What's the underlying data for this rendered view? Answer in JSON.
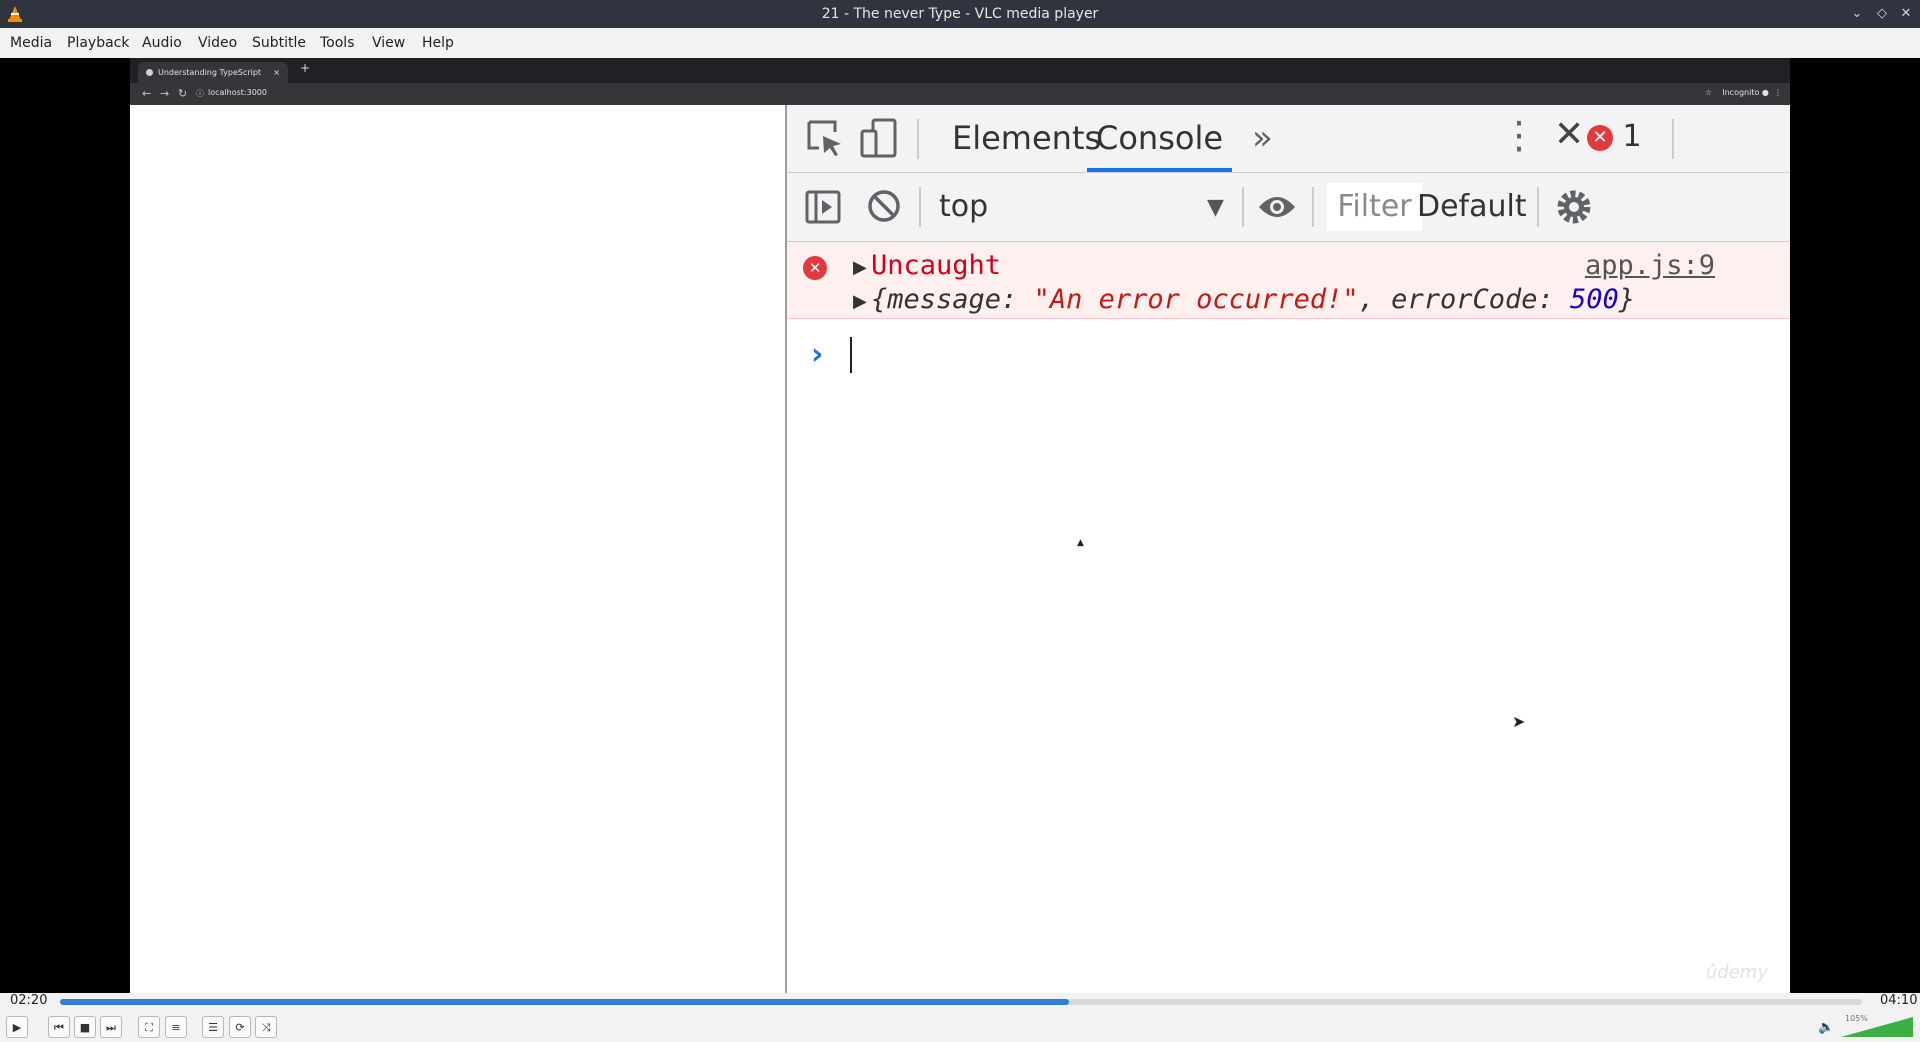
{
  "window": {
    "title": "21 - The never Type - VLC media player",
    "controls": [
      "minimize-icon",
      "maximize-icon",
      "close-icon"
    ]
  },
  "menubar": {
    "items": [
      "Media",
      "Playback",
      "Audio",
      "Video",
      "Subtitle",
      "Tools",
      "View",
      "Help"
    ]
  },
  "browser": {
    "tab_title": "Understanding TypeScript",
    "tab_close": "×",
    "new_tab": "+",
    "url": "localhost:3000",
    "incognito": "Incognito"
  },
  "devtools": {
    "tabs": [
      "Elements",
      "Console"
    ],
    "active_tab": "Console",
    "more_tabs": "»",
    "error_count": "1",
    "context": "top",
    "filter_placeholder": "Filter",
    "levels": "Default le",
    "console": {
      "uncaught": "Uncaught",
      "source": "app.js:9",
      "obj_open": "{message: ",
      "obj_message": "\"An error occurred!\"",
      "obj_mid": ", errorCode: ",
      "obj_code": "500",
      "obj_close": "}"
    },
    "watermark": "ûdemy"
  },
  "player": {
    "elapsed": "02:20",
    "total": "04:10",
    "progress": 0.56,
    "volume": "105%",
    "volume_level": 1.05,
    "colors": {
      "seek": "#2e7ed4",
      "volume": "#3cb043",
      "error_red": "#e0393e"
    }
  }
}
